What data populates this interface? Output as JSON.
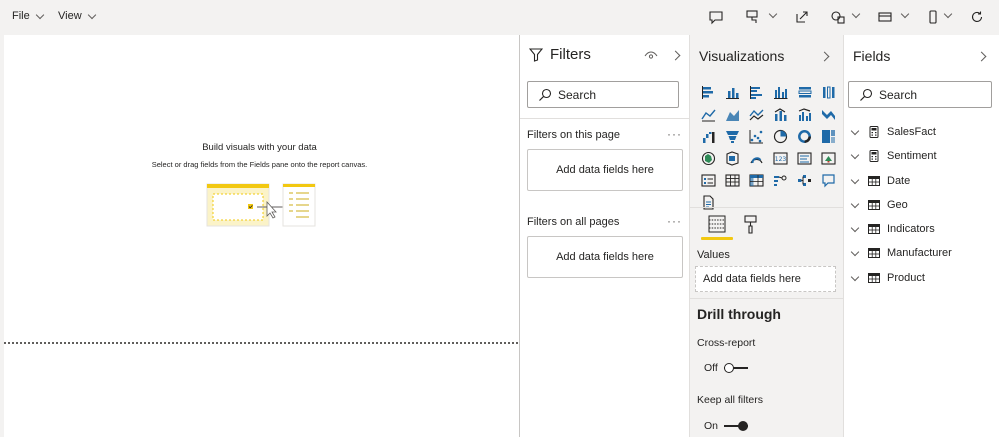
{
  "menu": {
    "file": "File",
    "view": "View"
  },
  "toolbar_icons": [
    "comment-icon",
    "format-painter-icon",
    "popout-icon",
    "shapes-icon",
    "layout-icon",
    "phone-layout-icon",
    "refresh-icon"
  ],
  "canvas": {
    "empty_title": "Build visuals with your data",
    "empty_subtitle": "Select or drag fields from the Fields pane onto the report canvas."
  },
  "filters": {
    "title": "Filters",
    "search_placeholder": "Search",
    "on_this_page": "Filters on this page",
    "on_this_page_well": "Add data fields here",
    "on_all_pages": "Filters on all pages",
    "on_all_pages_well": "Add data fields here",
    "more": "···"
  },
  "visualizations": {
    "title": "Visualizations",
    "icons": [
      "stacked-bar-chart-icon",
      "stacked-column-chart-icon",
      "clustered-bar-chart-icon",
      "clustered-column-chart-icon",
      "100-stacked-bar-chart-icon",
      "100-stacked-column-chart-icon",
      "line-chart-icon",
      "area-chart-icon",
      "stacked-area-chart-icon",
      "line-and-column-chart-icon",
      "line-and-clustered-column-chart-icon",
      "ribbon-chart-icon",
      "waterfall-chart-icon",
      "funnel-chart-icon",
      "scatter-chart-icon",
      "pie-chart-icon",
      "donut-chart-icon",
      "treemap-icon",
      "map-icon",
      "filled-map-icon",
      "gauge-icon",
      "card-icon",
      "multi-row-card-icon",
      "kpi-icon",
      "slicer-icon",
      "table-icon",
      "matrix-icon",
      "key-influencers-icon",
      "decomposition-tree-icon",
      "qa-icon",
      "paginated-report-icon"
    ],
    "values_label": "Values",
    "values_well": "Add data fields here",
    "drill_through": "Drill through",
    "cross_report": "Cross-report",
    "cross_report_state": "Off",
    "keep_all_filters": "Keep all filters",
    "keep_all_filters_state": "On"
  },
  "fields": {
    "title": "Fields",
    "search_placeholder": "Search",
    "items": [
      {
        "name": "SalesFact",
        "icon": "calculator-icon"
      },
      {
        "name": "Sentiment",
        "icon": "calculator-icon"
      },
      {
        "name": "Date",
        "icon": "table-icon"
      },
      {
        "name": "Geo",
        "icon": "table-icon"
      },
      {
        "name": "Indicators",
        "icon": "table-icon"
      },
      {
        "name": "Manufacturer",
        "icon": "table-icon"
      },
      {
        "name": "Product",
        "icon": "table-icon"
      }
    ]
  },
  "colors": {
    "accent": "#f2c811",
    "pane_bg": "#f3f2f1",
    "blue": "#1f6aa8"
  }
}
